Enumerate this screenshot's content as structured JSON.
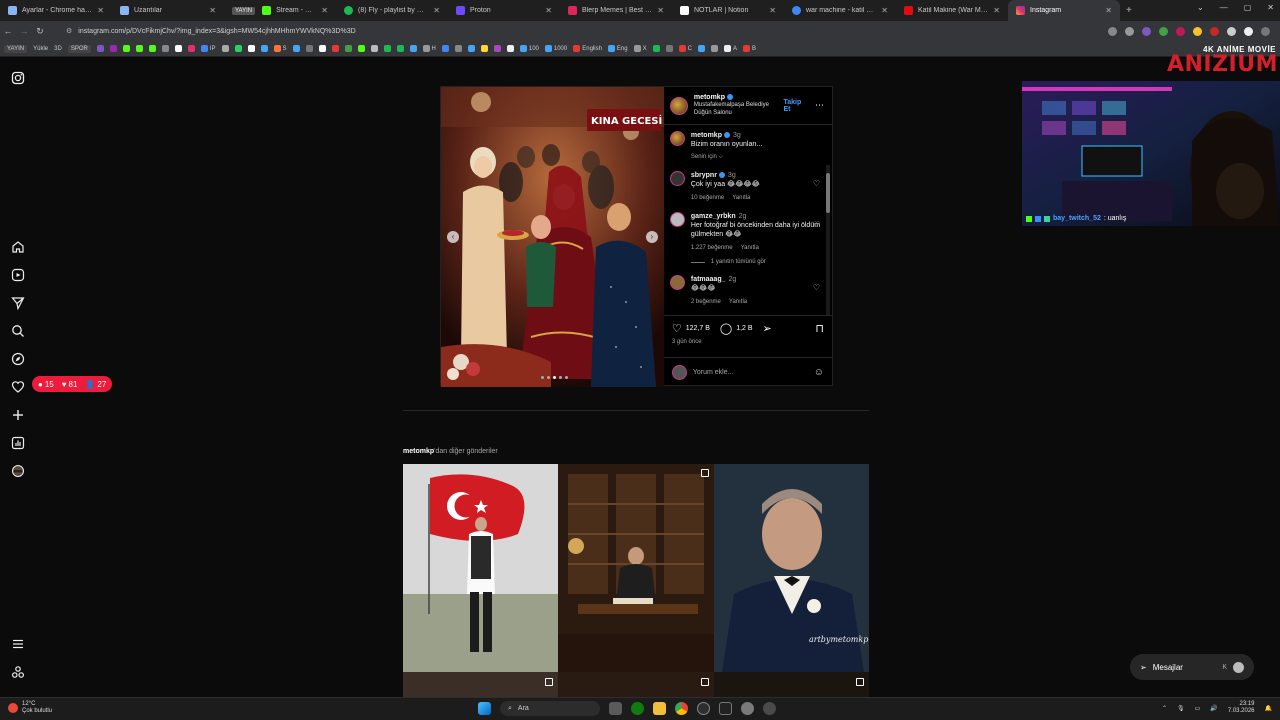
{
  "browser": {
    "tabs": [
      {
        "title": "Ayarlar - Chrome hakkında",
        "color": "#8ab4f8"
      },
      {
        "title": "Uzantılar",
        "color": "#8ab4f8"
      },
      {
        "title": "Stream - Kick Dashboard",
        "color": "#53fc18",
        "live": "YAYIN"
      },
      {
        "title": "(8) Fly - playlist by Mimsnicto",
        "color": "#1db954"
      },
      {
        "title": "Proton",
        "color": "#6d4aff"
      },
      {
        "title": "Blerp Memes | Best Streamer",
        "color": "#e0245e"
      },
      {
        "title": "NOTLAR | Notion",
        "color": "#ffffff"
      },
      {
        "title": "war machine - katil makine -",
        "color": "#4285f4"
      },
      {
        "title": "Katil Makine (War Machine)",
        "color": "#e50914"
      },
      {
        "title": "Instagram",
        "color": "#e1306c",
        "active": true
      }
    ],
    "url": "instagram.com/p/DVcFikmjChv/?img_index=3&igsh=MW54cjhhMHhmYWVkNQ%3D%3D",
    "bookmarks": [
      {
        "label": "YAYIN",
        "badge": true
      },
      {
        "label": "Yükle"
      },
      {
        "label": "3D"
      },
      {
        "label": "SPOR"
      },
      {
        "label": "IP"
      },
      {
        "label": "S"
      },
      {
        "label": "H"
      },
      {
        "label": "100"
      },
      {
        "label": "1000"
      },
      {
        "label": "English"
      },
      {
        "label": "Eng"
      },
      {
        "label": "X"
      },
      {
        "label": "C"
      },
      {
        "label": "A"
      },
      {
        "label": "B"
      }
    ]
  },
  "post": {
    "username": "metomkp",
    "location": "Mustafakemalpaşa Belediye Düğün Salonu",
    "follow_label": "Takip Et",
    "caption_user": "metomkp",
    "caption_time": "3g",
    "caption_text": "Bizim oranın oyunları...",
    "translate_label": "Senin için ⌵",
    "comments": [
      {
        "user": "sbrypnr",
        "time": "3g",
        "text": "Çok iyi yaa 😂😂😂😂",
        "likes": "10 beğenme",
        "reply": "Yanıtla"
      },
      {
        "user": "gamze_yrbkn",
        "time": "2g",
        "text": "Her fotoğraf bi öncekinden daha iyi öldüm gülmekten 😂😂",
        "likes": "1.227 beğenme",
        "reply": "Yanıtla"
      },
      {
        "user": "fatmaaag_",
        "time": "2g",
        "text": "😂😂😂",
        "likes": "2 beğenme",
        "reply": "Yanıtla"
      }
    ],
    "replies_label": "1 yanıtın tümünü gör",
    "likes_count": "122,7 B",
    "comments_count": "1,2 B",
    "posted_ago": "3 gün önce",
    "add_comment_placeholder": "Yorum ekle...",
    "image_sign": "KINA GECESİ",
    "carousel_dots": 5
  },
  "more_from": {
    "user": "metomkp",
    "suffix": "'dan diğer gönderiler",
    "watermark": "artbymetomkp"
  },
  "notifications": {
    "comments": "15",
    "likes": "81",
    "follows": "27"
  },
  "messages": {
    "label": "Mesajlar",
    "initial": "K"
  },
  "stream": {
    "chat_user": "bay_twitch_52",
    "chat_text": ": uanlış",
    "brand_small": "4K ANİME MOVİE",
    "brand_big": "ANIZIUM"
  },
  "taskbar": {
    "temp": "12°C",
    "weather": "Çok bulutlu",
    "search": "Ara",
    "time": "23:19",
    "date": "7.03.2026"
  }
}
